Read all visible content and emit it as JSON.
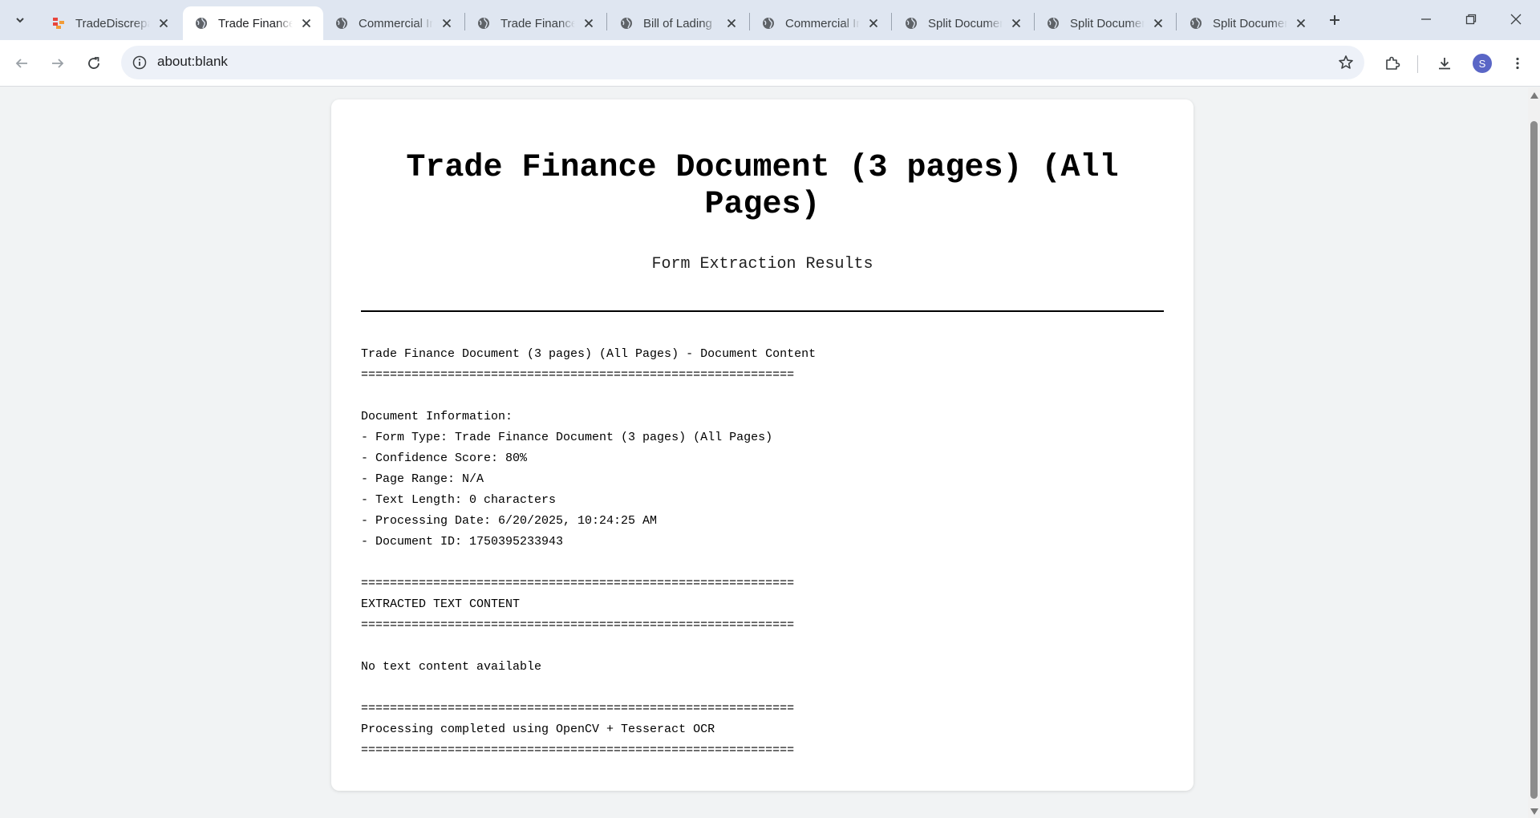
{
  "tabs": [
    {
      "title": "TradeDiscrepancy",
      "favicon": "app-logo-icon",
      "active": false
    },
    {
      "title": "Trade Finance Document",
      "favicon": "globe-icon",
      "active": true
    },
    {
      "title": "Commercial Invoice",
      "favicon": "globe-icon",
      "active": false
    },
    {
      "title": "Trade Finance Document",
      "favicon": "globe-icon",
      "active": false
    },
    {
      "title": "Bill of Lading",
      "favicon": "globe-icon",
      "active": false
    },
    {
      "title": "Commercial Invoice",
      "favicon": "globe-icon",
      "active": false
    },
    {
      "title": "Split Document",
      "favicon": "globe-icon",
      "active": false
    },
    {
      "title": "Split Document",
      "favicon": "globe-icon",
      "active": false
    },
    {
      "title": "Split Document",
      "favicon": "globe-icon",
      "active": false
    }
  ],
  "toolbar": {
    "url": "about:blank",
    "profile_initial": "S"
  },
  "document": {
    "title": "Trade Finance Document (3 pages) (All Pages)",
    "subtitle": "Form Extraction Results",
    "lines": [
      "Trade Finance Document (3 pages) (All Pages) - Document Content",
      "============================================================",
      "",
      "Document Information:",
      "- Form Type: Trade Finance Document (3 pages) (All Pages)",
      "- Confidence Score: 80%",
      "- Page Range: N/A",
      "- Text Length: 0 characters",
      "- Processing Date: 6/20/2025, 10:24:25 AM",
      "- Document ID: 1750395233943",
      "",
      "============================================================",
      "EXTRACTED TEXT CONTENT",
      "============================================================",
      "",
      "No text content available",
      "",
      "============================================================",
      "Processing completed using OpenCV + Tesseract OCR",
      "============================================================"
    ]
  },
  "colors": {
    "tabstrip_bg": "#dfe6f1",
    "omnibox_bg": "#edf1f8",
    "avatar_bg": "#5a66c6",
    "page_bg": "#f1f3f4"
  }
}
